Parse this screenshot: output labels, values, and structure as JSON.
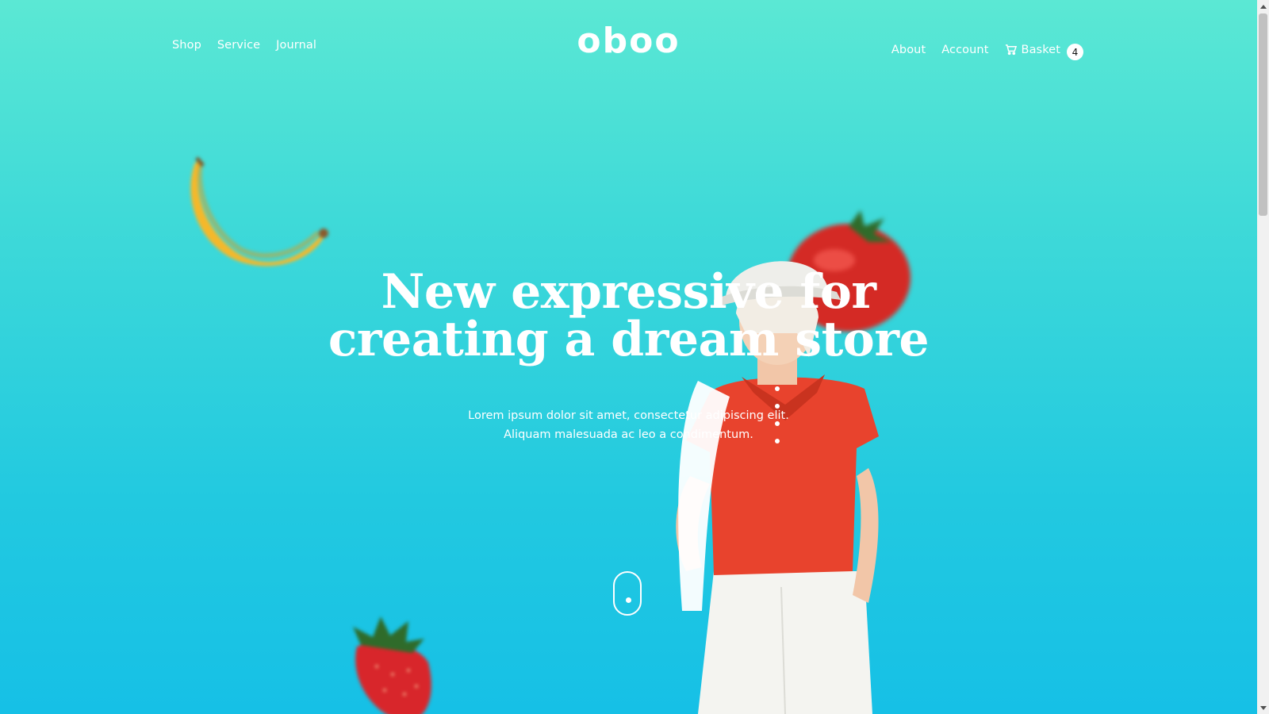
{
  "header": {
    "logo": "oboo",
    "nav_left": [
      {
        "label": "Shop"
      },
      {
        "label": "Service"
      },
      {
        "label": "Journal"
      }
    ],
    "nav_right": [
      {
        "label": "About"
      },
      {
        "label": "Account"
      }
    ],
    "basket": {
      "label": "Basket",
      "count": "4",
      "icon": "cart-icon"
    }
  },
  "hero": {
    "title_line1": "New expressive for",
    "title_line2": "creating a dream store",
    "subtitle": "Lorem ipsum dolor sit amet, consectetur adipiscing elit. Aliquam malesuada ac leo a condimentum.",
    "scroll_icon": "mouse-scroll-icon"
  },
  "colors": {
    "gradient_top": "#5be8d4",
    "gradient_bottom": "#16c0e6",
    "text": "#ffffff",
    "shirt_red": "#e8432d"
  }
}
